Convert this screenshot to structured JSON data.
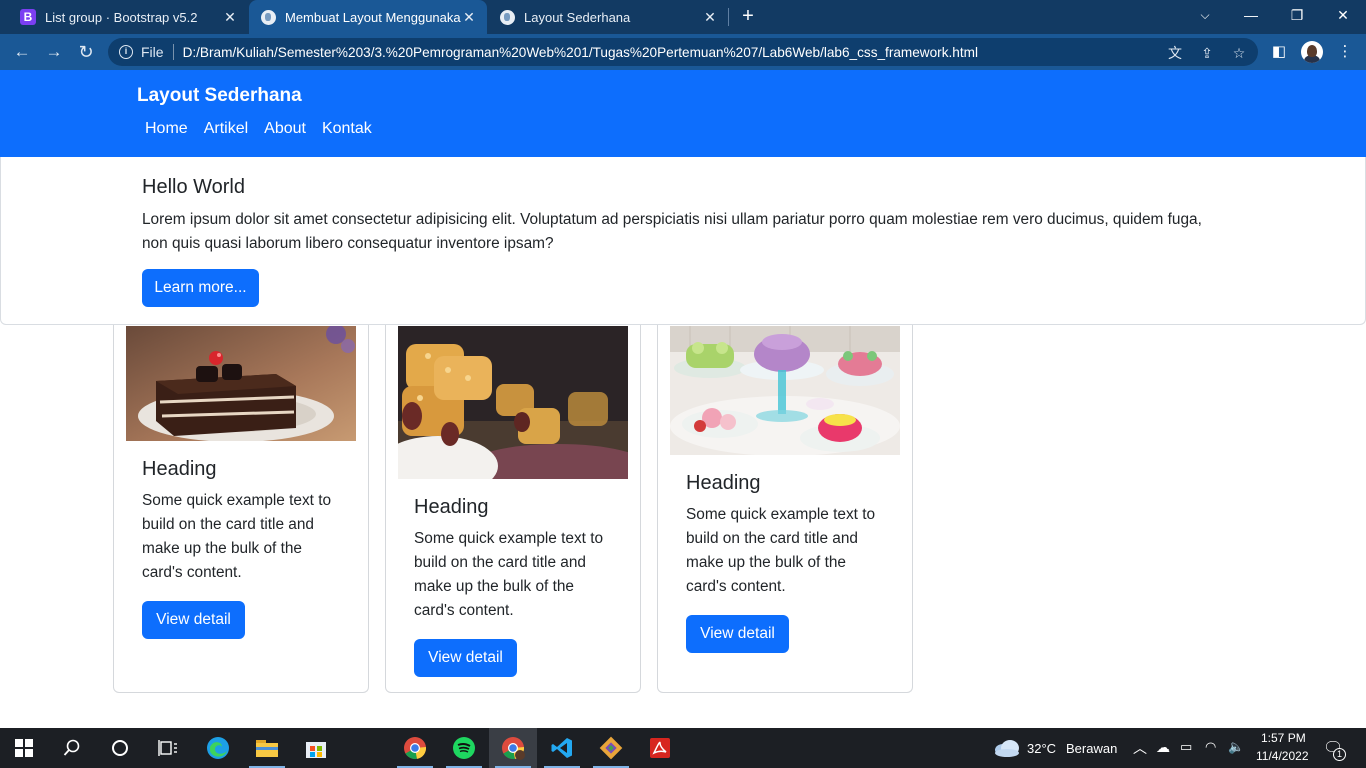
{
  "browser": {
    "tabs": [
      {
        "title": "List group · Bootstrap v5.2",
        "favicon": "bootstrap-icon",
        "active": false
      },
      {
        "title": "Membuat Layout Menggunakan",
        "favicon": "globe-icon",
        "active": true
      },
      {
        "title": "Layout Sederhana",
        "favicon": "globe-icon",
        "active": false
      }
    ],
    "omnibox": {
      "scheme_label": "File",
      "url": "D:/Bram/Kuliah/Semester%203/3.%20Pemrograman%20Web%201/Tugas%20Pertemuan%207/Lab6Web/lab6_css_framework.html"
    }
  },
  "page": {
    "navbar": {
      "brand": "Layout Sederhana",
      "links": [
        "Home",
        "Artikel",
        "About",
        "Kontak"
      ],
      "color": "#0d6efd"
    },
    "hero": {
      "title": "Hello World",
      "text": "Lorem ipsum dolor sit amet consectetur adipisicing elit. Voluptatum ad perspiciatis nisi ullam pariatur porro quam molestiae rem vero ducimus, quidem fuga, non quis quasi laborum libero consequatur inventore ipsam?",
      "button": "Learn more..."
    },
    "cards": [
      {
        "heading": "Heading",
        "text": "Some quick example text to build on the card title and make up the bulk of the card's content.",
        "button": "View detail",
        "image": "chocolate-cake-photo"
      },
      {
        "heading": "Heading",
        "text": "Some quick example text to build on the card title and make up the bulk of the card's content.",
        "button": "View detail",
        "image": "pineapple-tart-photo"
      },
      {
        "heading": "Heading",
        "text": "Some quick example text to build on the card title and make up the bulk of the card's content.",
        "button": "View detail",
        "image": "dessert-table-photo"
      }
    ]
  },
  "taskbar": {
    "weather": {
      "temp": "32°C",
      "condition": "Berawan"
    },
    "time": "1:57 PM",
    "date": "11/4/2022",
    "notification_count": "1",
    "apps": [
      "start-icon",
      "search-icon",
      "cortana-icon",
      "task-view-icon",
      "edge-icon",
      "file-explorer-icon",
      "store-icon",
      "chrome-icon",
      "spotify-icon",
      "chrome-profile-icon",
      "vscode-icon",
      "git-icon",
      "acrobat-icon"
    ]
  }
}
